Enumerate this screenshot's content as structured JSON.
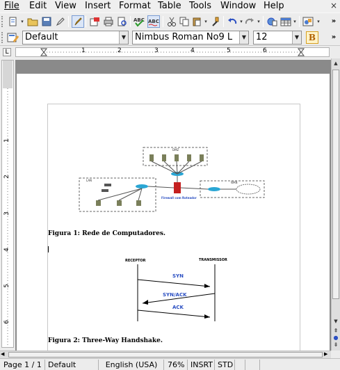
{
  "menu": {
    "file": "File",
    "edit": "Edit",
    "view": "View",
    "insert": "Insert",
    "format": "Format",
    "table": "Table",
    "tools": "Tools",
    "window": "Window",
    "help": "Help",
    "close_glyph": "×"
  },
  "formatting": {
    "paragraph_style": "Default",
    "font_name": "Nimbus Roman No9 L",
    "font_size": "12"
  },
  "ruler": {
    "h_numbers": [
      "1",
      "2",
      "3",
      "4",
      "5",
      "6"
    ],
    "v_numbers": [
      "1",
      "2",
      "3",
      "4",
      "5",
      "6"
    ]
  },
  "figures": {
    "fig1_caption": "Figura 1: Rede de Computadores.",
    "fig1_labels": {
      "dmz": "DMZ",
      "lan": "LAN",
      "wan": "WAN",
      "firewall": "Firewall com Roteador"
    },
    "fig2_caption": "Figura 2: Three-Way Handshake.",
    "fig2_labels": {
      "receptor": "RECEPTOR",
      "transmissor": "TRANSMISSOR",
      "syn": "SYN",
      "synack": "SYN/ACK",
      "ack": "ACK"
    }
  },
  "status": {
    "page": "Page 1 / 1",
    "style": "Default",
    "language": "English (USA)",
    "zoom": "76%",
    "insert_mode": "INSRT",
    "selection_mode": "STD"
  },
  "colors": {
    "accent": "#2b4fc2",
    "firewall_red": "#c42020",
    "device_cyan": "#2aa6d4"
  }
}
